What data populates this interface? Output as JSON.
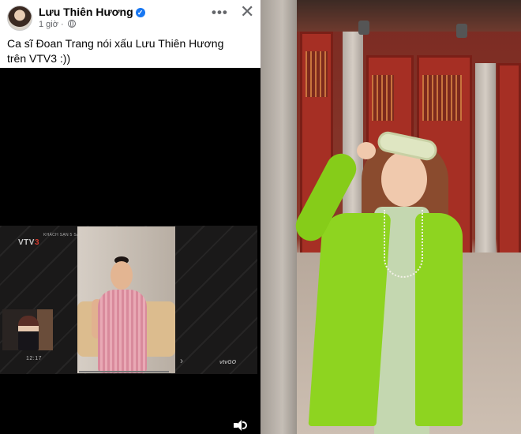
{
  "post": {
    "author": "Lưu Thiên Hương",
    "time": "1 giờ",
    "meta_separator": "·",
    "verified_glyph": "✓",
    "caption": "Ca sĩ Đoan Trang nói xấu Lưu Thiên Hương trên VTV3 :))",
    "more_glyph": "•••",
    "close_glyph": "✕"
  },
  "video": {
    "channel_prefix": "VTV",
    "channel_number": "3",
    "show_name": "KHÁCH SẠN 5 SAO",
    "inset_timestamp": "12:17",
    "logo_text": "vtv",
    "logo_sub": "GO",
    "next_glyph": "›"
  },
  "icons": {
    "verified": "verified-badge-icon",
    "globe": "globe-icon",
    "more": "more-options-icon",
    "close": "close-icon",
    "volume": "volume-icon"
  },
  "colors": {
    "verified_blue": "#1877f2",
    "meta_gray": "#65676b",
    "blazer_green": "#8ed420",
    "wall_red": "#a62f24"
  }
}
